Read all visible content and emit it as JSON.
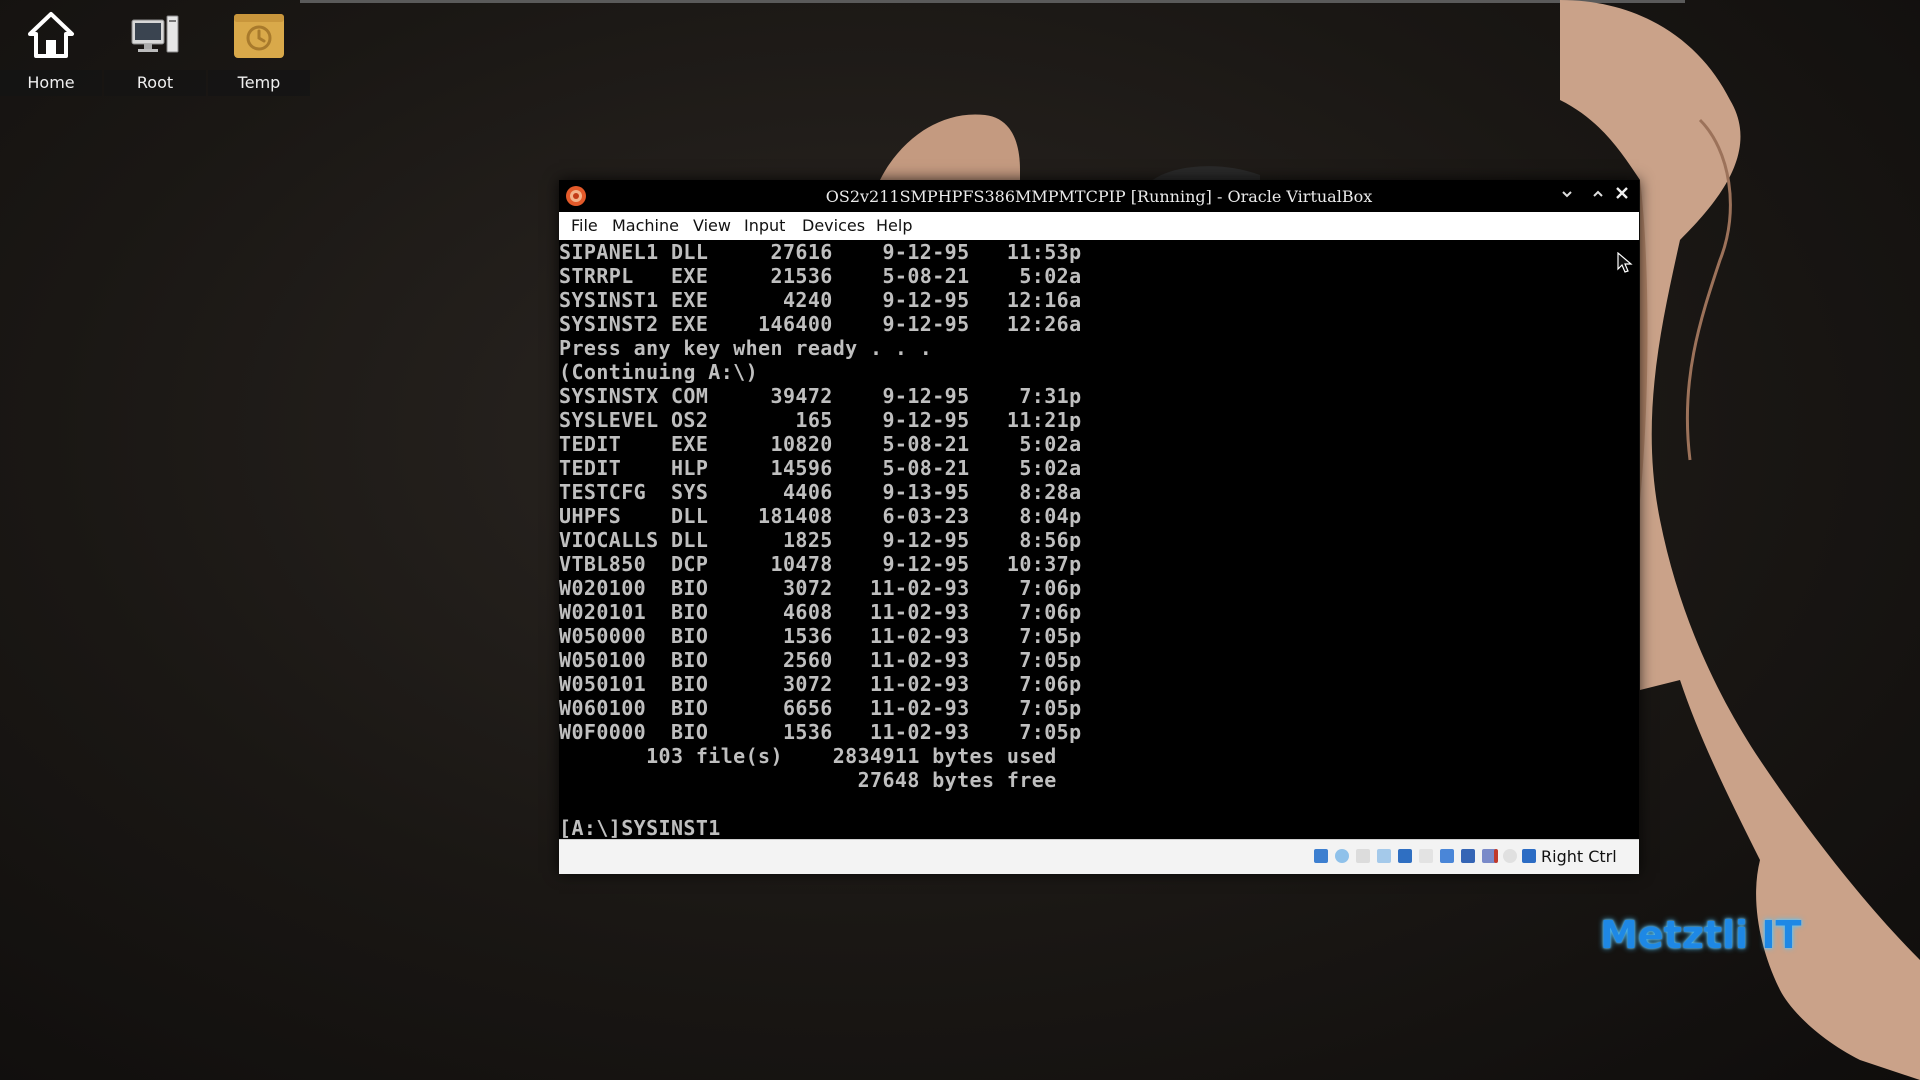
{
  "desktop": {
    "icons": [
      {
        "label": "Home",
        "icon": "home-icon"
      },
      {
        "label": "Root",
        "icon": "computer-icon"
      },
      {
        "label": "Temp",
        "icon": "folder-clock-icon"
      }
    ],
    "brand": "Metztli IT"
  },
  "window": {
    "title": "OS2v211SMPHPFS386MMPMTCPIP [Running] - Oracle VirtualBox",
    "menu": [
      "File",
      "Machine",
      "View",
      "Input",
      "Devices",
      "Help"
    ],
    "host_key": "Right Ctrl"
  },
  "console": {
    "text": "SIPANEL1 DLL     27616    9-12-95   11:53p\nSTRRPL   EXE     21536    5-08-21    5:02a\nSYSINST1 EXE      4240    9-12-95   12:16a\nSYSINST2 EXE    146400    9-12-95   12:26a\nPress any key when ready . . .\n(Continuing A:\\)\nSYSINSTX COM     39472    9-12-95    7:31p\nSYSLEVEL OS2       165    9-12-95   11:21p\nTEDIT    EXE     10820    5-08-21    5:02a\nTEDIT    HLP     14596    5-08-21    5:02a\nTESTCFG  SYS      4406    9-13-95    8:28a\nUHPFS    DLL    181408    6-03-23    8:04p\nVIOCALLS DLL      1825    9-12-95    8:56p\nVTBL850  DCP     10478    9-12-95   10:37p\nW020100  BIO      3072   11-02-93    7:06p\nW020101  BIO      4608   11-02-93    7:06p\nW050000  BIO      1536   11-02-93    7:05p\nW050100  BIO      2560   11-02-93    7:05p\nW050101  BIO      3072   11-02-93    7:06p\nW060100  BIO      6656   11-02-93    7:05p\nW0F0000  BIO      1536   11-02-93    7:05p\n       103 file(s)    2834911 bytes used\n                        27648 bytes free\n\n[A:\\]SYSINST1"
  }
}
